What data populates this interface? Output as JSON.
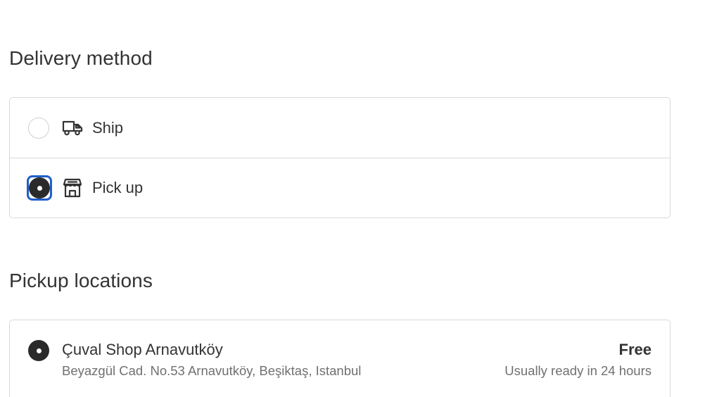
{
  "delivery": {
    "heading": "Delivery method",
    "options": [
      {
        "label": "Ship",
        "icon": "truck-icon",
        "selected": false
      },
      {
        "label": "Pick up",
        "icon": "store-icon",
        "selected": true
      }
    ]
  },
  "pickup": {
    "heading": "Pickup locations",
    "locations": [
      {
        "name": "Çuval Shop Arnavutköy",
        "address": "Beyazgül Cad. No.53 Arnavutköy, Beşiktaş, Istanbul",
        "price": "Free",
        "eta": "Usually ready in 24 hours",
        "selected": true
      }
    ]
  },
  "colors": {
    "text": "#333333",
    "muted": "#707070",
    "border": "#d9d9d9",
    "focus": "#1f5fc7",
    "radio_checked": "#2a2a2a"
  }
}
